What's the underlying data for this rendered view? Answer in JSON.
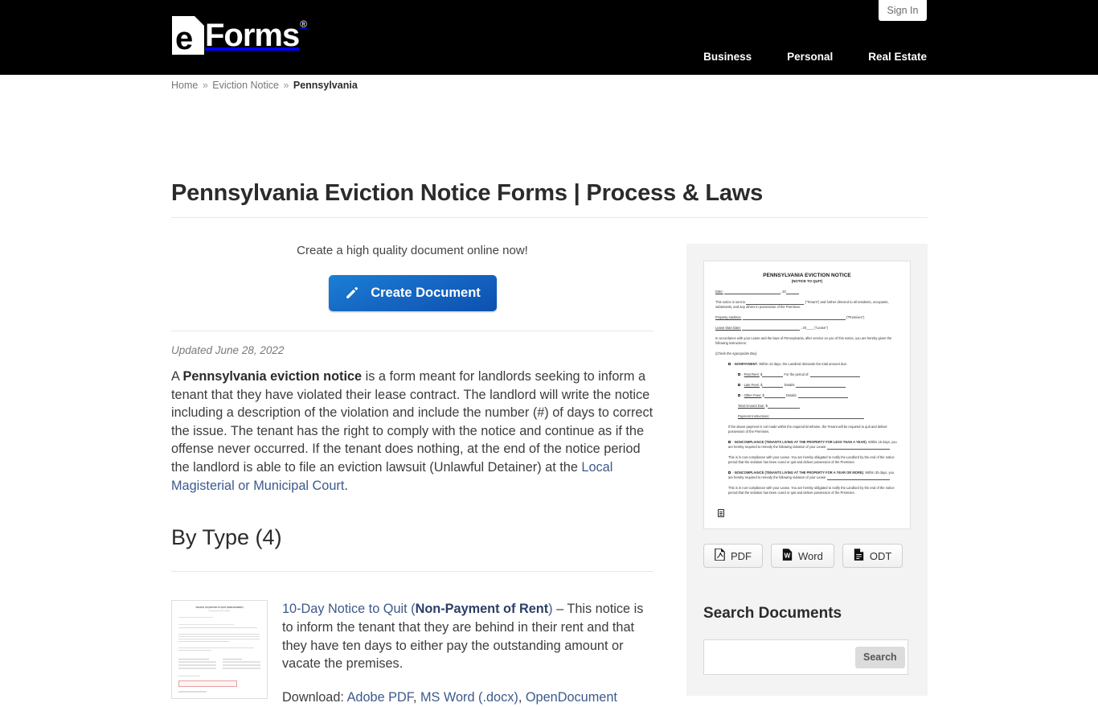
{
  "header": {
    "signin_label": "Sign In",
    "logo": {
      "mark_letter": "e",
      "word": "Forms",
      "reg": "®"
    },
    "nav": [
      {
        "label": "Business"
      },
      {
        "label": "Personal"
      },
      {
        "label": "Real Estate"
      }
    ]
  },
  "breadcrumb": {
    "home": "Home",
    "sep1": "»",
    "category": "Eviction Notice",
    "sep2": "»",
    "current": "Pennsylvania"
  },
  "page_title": "Pennsylvania Eviction Notice Forms | Process & Laws",
  "cta": {
    "tagline": "Create a high quality document online now!",
    "button_label": "Create Document",
    "button_icon": "pencil-icon",
    "button_color": "#1668c4"
  },
  "article": {
    "updated": "Updated June 28, 2022",
    "intro_part1": "A ",
    "intro_bold": "Pennsylvania eviction notice",
    "intro_part2": " is a form meant for landlords seeking to inform a tenant that they have violated their lease contract. The landlord will write the notice including a description of the violation and include the number (#) of days to correct the issue. The tenant has the right to comply with the notice and continue as if the offense never occurred. If the tenant does nothing, at the end of the notice period the landlord is able to file an eviction lawsuit (Unlawful Detainer) at the ",
    "intro_link": "Local Magisterial or Municipal Court",
    "intro_part3": "."
  },
  "by_type": {
    "heading": "By Type (4)",
    "items": [
      {
        "link_text": "10-Day Notice to Quit (",
        "link_bold": "Non-Payment of Rent",
        "link_close": ")",
        "description": " – This notice is to inform the tenant that they are behind in their rent and that they have ten days to either pay the outstanding amount or vacate the premises.",
        "download_label": "Download: ",
        "downloads": [
          "Adobe PDF",
          "MS Word (.docx)",
          "OpenDocument"
        ],
        "thumb_title": "TEN DAY (10) NOTICE TO QUIT (NON-PAYMENT)",
        "thumb_sub": "Pennsylvania Eviction Notice"
      }
    ]
  },
  "sidebar": {
    "preview": {
      "title": "PENNSYLVANIA EVICTION NOTICE",
      "subtitle": "(NOTICE TO QUIT)",
      "date_label": "Date:",
      "date_year": ", 20",
      "p_notice_1": "This notice is sent to ",
      "p_notice_tenant": "(“Tenant”) and further directed to all residents, occupants, subtenants, and any others in possession of the Premises.",
      "property_label": "Property Address:",
      "property_tail": "(“Premises”)",
      "lease_label": "Lease Start Date:",
      "lease_tail": ", 20____ (“Lease”)",
      "p_accordance": "In accordance with your Lease and the laws of Pennsylvania, after service on you of this notice, you are hereby given the following instructions:",
      "check_box_note": "(Check the Appropriate Box)",
      "nonpayment_title": "NONPAYMENT",
      "nonpayment_text": ". Within 10 days, the Landlord demands the total amount due:",
      "past_rent": "Past Rent:",
      "past_rent_tail": "For the period of:",
      "late_fees": "Late Fees:",
      "late_fees_tail": "Details:",
      "other_fees": "Other Fees:",
      "other_fees_tail": "Details:",
      "total_due": "Total Amount Due:",
      "payment_instructions": "Payment Instructions:",
      "p_ifabove": "If the above payment is not made within the required timeframe, the Tenant will be required to quit and deliver possession of the Premises.",
      "noncompliance_less_title": "NONCOMPLIANCE (TENANTS LIVING AT THE PROPERTY FOR LESS THAN A YEAR)",
      "noncompliance_less_text": ". Within 15 days, you are hereby required to remedy the following violation of your Lease:",
      "p_noncompliance_1": "This is in non-compliance with your Lease. You are hereby obligated to notify the Landlord by the end of the notice period that the violation has been cured or quit and deliver possession of the Premises.",
      "noncompliance_more_title": "NONCOMPLIANCE (TENANTS LIVING AT THE PROPERTY FOR A YEAR OR MORE)",
      "noncompliance_more_text": ". Within 30 days, you are hereby required to remedy the following violation of your Lease:",
      "p_noncompliance_2": "This is in non-compliance with your Lease. You are hereby obligated to notify the Landlord by the end of the notice period that the violation has been cured or quit and deliver possession of the Premises."
    },
    "download_buttons": [
      {
        "label": "PDF",
        "icon": "pdf-file-icon"
      },
      {
        "label": "Word",
        "icon": "word-file-icon"
      },
      {
        "label": "ODT",
        "icon": "odt-file-icon"
      }
    ],
    "search": {
      "heading": "Search Documents",
      "value": "",
      "placeholder": "",
      "button_label": "Search"
    }
  }
}
